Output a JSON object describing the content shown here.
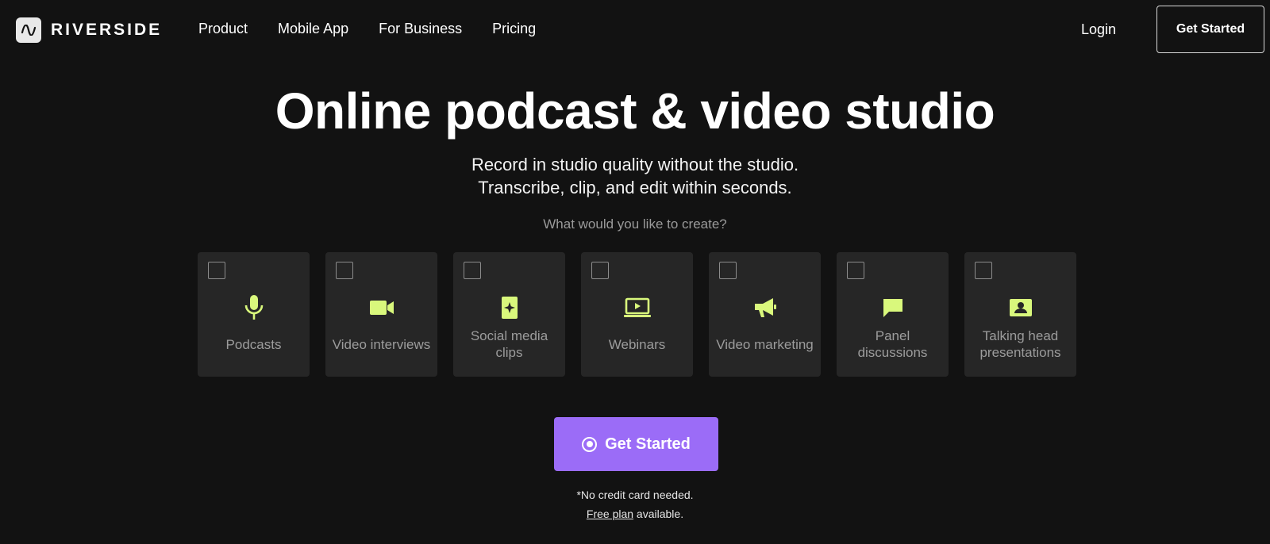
{
  "nav": {
    "logo_text": "RIVERSIDE",
    "links": [
      "Product",
      "Mobile App",
      "For Business",
      "Pricing"
    ],
    "login_label": "Login",
    "cta_label": "Get Started"
  },
  "hero": {
    "title": "Online podcast & video studio",
    "subtitle_line1": "Record in studio quality without the studio.",
    "subtitle_line2": "Transcribe, clip, and edit within seconds.",
    "prompt": "What would you like to create?"
  },
  "options": [
    {
      "label": "Podcasts",
      "icon": "microphone-icon",
      "checked": false
    },
    {
      "label": "Video interviews",
      "icon": "video-camera-icon",
      "checked": false
    },
    {
      "label": "Social media clips",
      "icon": "sparkle-phone-icon",
      "checked": false
    },
    {
      "label": "Webinars",
      "icon": "laptop-play-icon",
      "checked": false
    },
    {
      "label": "Video marketing",
      "icon": "megaphone-icon",
      "checked": false
    },
    {
      "label": "Panel discussions",
      "icon": "chat-bubble-icon",
      "checked": false
    },
    {
      "label": "Talking head presentations",
      "icon": "person-card-icon",
      "checked": false
    }
  ],
  "cta": {
    "label": "Get Started",
    "icon": "record-icon"
  },
  "footnote": {
    "line1": "*No credit card needed.",
    "link_text": "Free plan",
    "line2_rest": " available."
  },
  "colors": {
    "background": "#121212",
    "card": "#262626",
    "accent_icon": "#d9f87c",
    "cta": "#9b6cf7"
  }
}
